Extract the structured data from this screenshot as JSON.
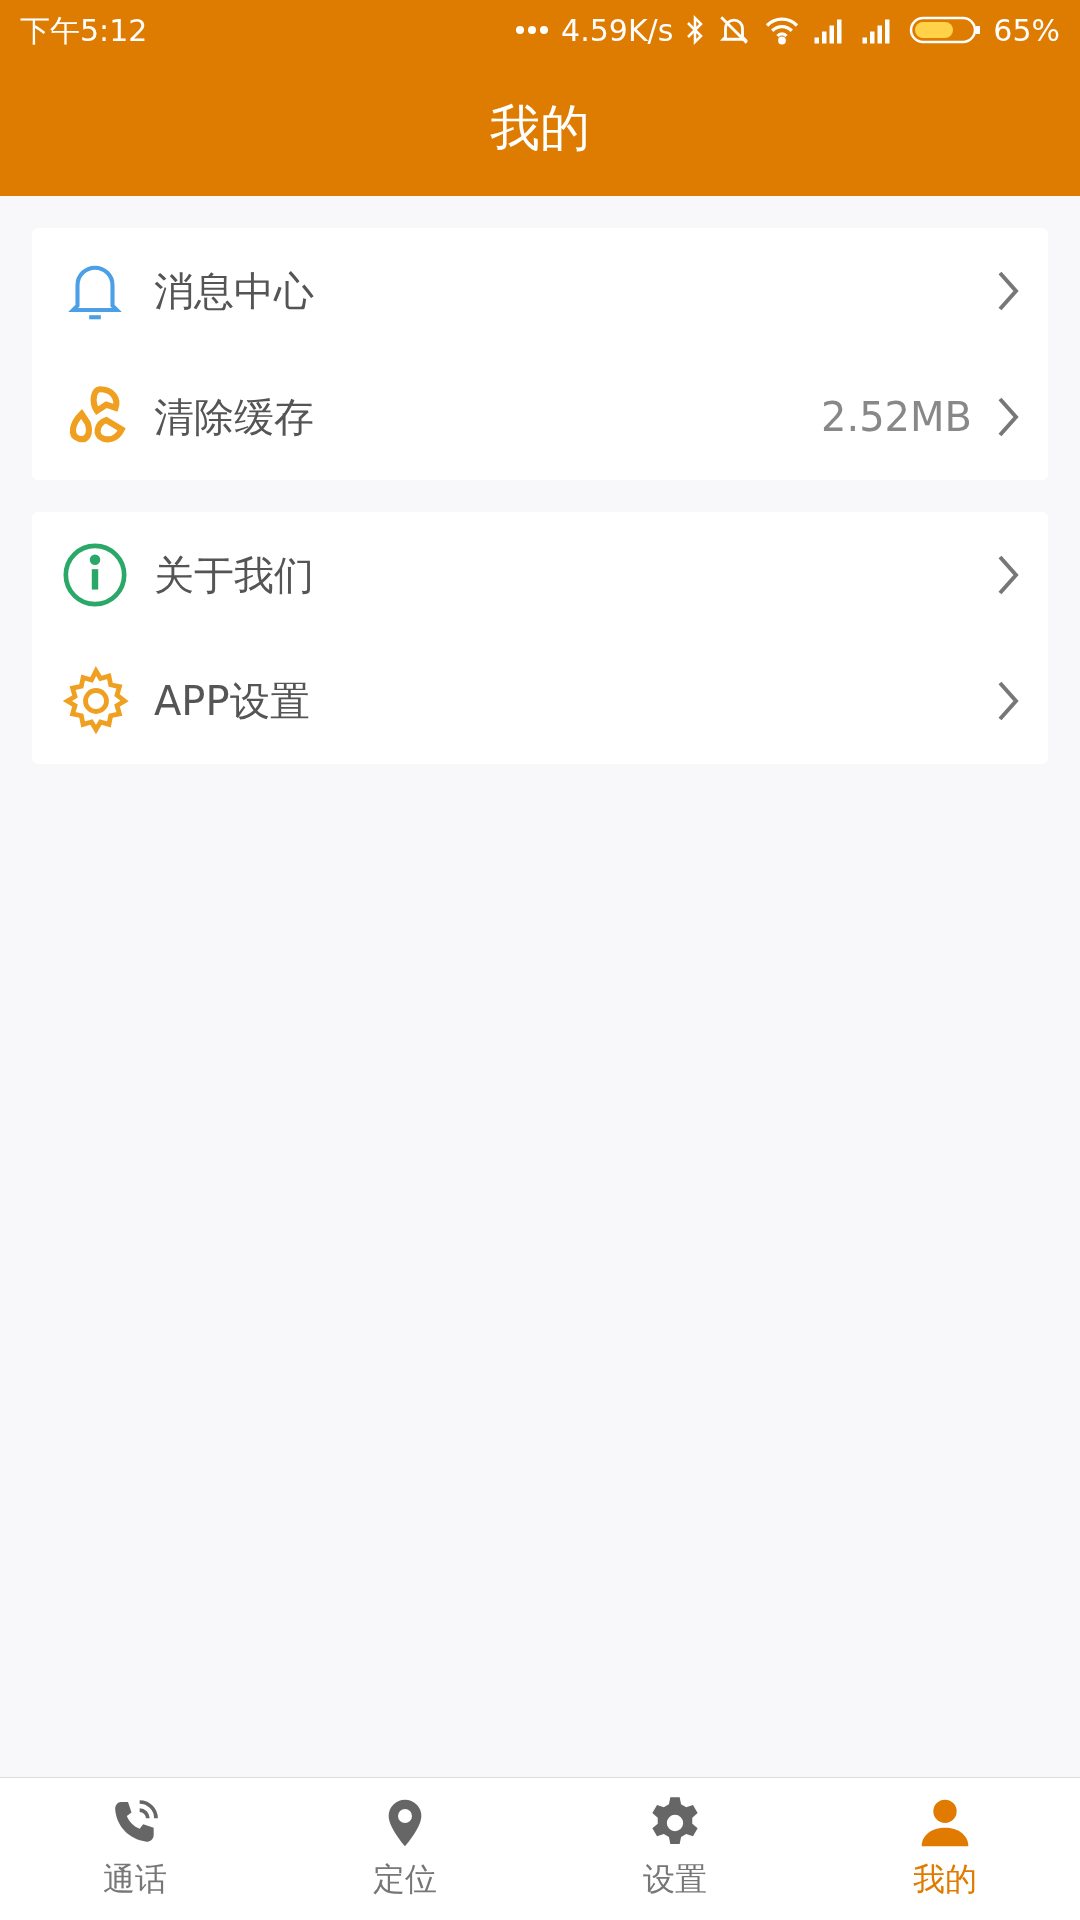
{
  "status_bar": {
    "time": "下午5:12",
    "speed": "4.59K/s",
    "battery": "65%"
  },
  "header": {
    "title": "我的"
  },
  "groups": [
    [
      {
        "label": "消息中心"
      },
      {
        "label": "清除缓存",
        "value": "2.52MB"
      }
    ],
    [
      {
        "label": "关于我们"
      },
      {
        "label": "APP设置"
      }
    ]
  ],
  "tabs": [
    {
      "label": "通话",
      "selected": false
    },
    {
      "label": "定位",
      "selected": false
    },
    {
      "label": "设置",
      "selected": false
    },
    {
      "label": "我的",
      "selected": true
    }
  ]
}
